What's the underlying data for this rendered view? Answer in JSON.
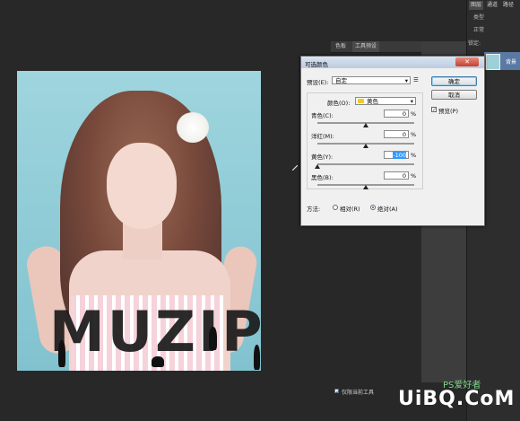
{
  "colors": {
    "accent": "#3399ff",
    "canvas_bg": "#282828",
    "dialog_bg": "#f0f0f0",
    "color_swatch": "#f5c823"
  },
  "mini_panel": {
    "tabs": [
      "色板",
      "工具预设"
    ]
  },
  "right_panel": {
    "tabs": [
      "图层",
      "通道",
      "路径"
    ],
    "kind_label": "类型",
    "blend_label": "正常",
    "lock_label": "锁定:",
    "layer_name": "背景"
  },
  "canvas": {
    "logo_text": "MUZIPP",
    "tagline": "· · · · · · · · · ·"
  },
  "dialog": {
    "title": "可选颜色",
    "preset_label": "预设(E):",
    "preset_value": "自定",
    "colors_label": "颜色(O):",
    "colors_value": "黄色",
    "ok_label": "确定",
    "cancel_label": "取消",
    "preview_label": "预览(P)",
    "sliders": [
      {
        "label": "青色(C):",
        "value": "0",
        "unit": "%",
        "pos": 0.5
      },
      {
        "label": "洋红(M):",
        "value": "0",
        "unit": "%",
        "pos": 0.5
      },
      {
        "label": "黄色(Y):",
        "value": "-100",
        "unit": "%",
        "pos": 0.0
      },
      {
        "label": "黑色(B):",
        "value": "0",
        "unit": "%",
        "pos": 0.5
      }
    ],
    "method_label": "方法:",
    "relative_label": "相对(R)",
    "absolute_label": "绝对(A)",
    "selected_method": "absolute"
  },
  "bottom_option": "仅限当前工具",
  "watermark": {
    "ps": "PS爱好者",
    "site": "UiBQ.CoM"
  }
}
